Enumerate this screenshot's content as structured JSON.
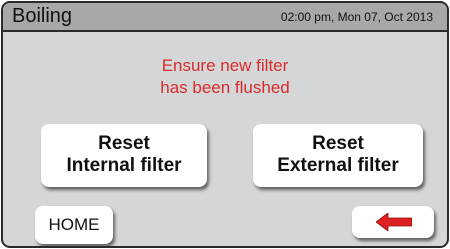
{
  "header": {
    "title": "Boiling",
    "datetime": "02:00 pm, Mon 07, Oct 2013"
  },
  "message": {
    "line1": "Ensure new filter",
    "line2": "has been flushed",
    "color": "#d92b2b"
  },
  "buttons": {
    "reset_internal": {
      "line1": "Reset",
      "line2": "Internal filter"
    },
    "reset_external": {
      "line1": "Reset",
      "line2": "External filter"
    },
    "home_label": "HOME",
    "back_icon": "left-arrow-icon"
  }
}
